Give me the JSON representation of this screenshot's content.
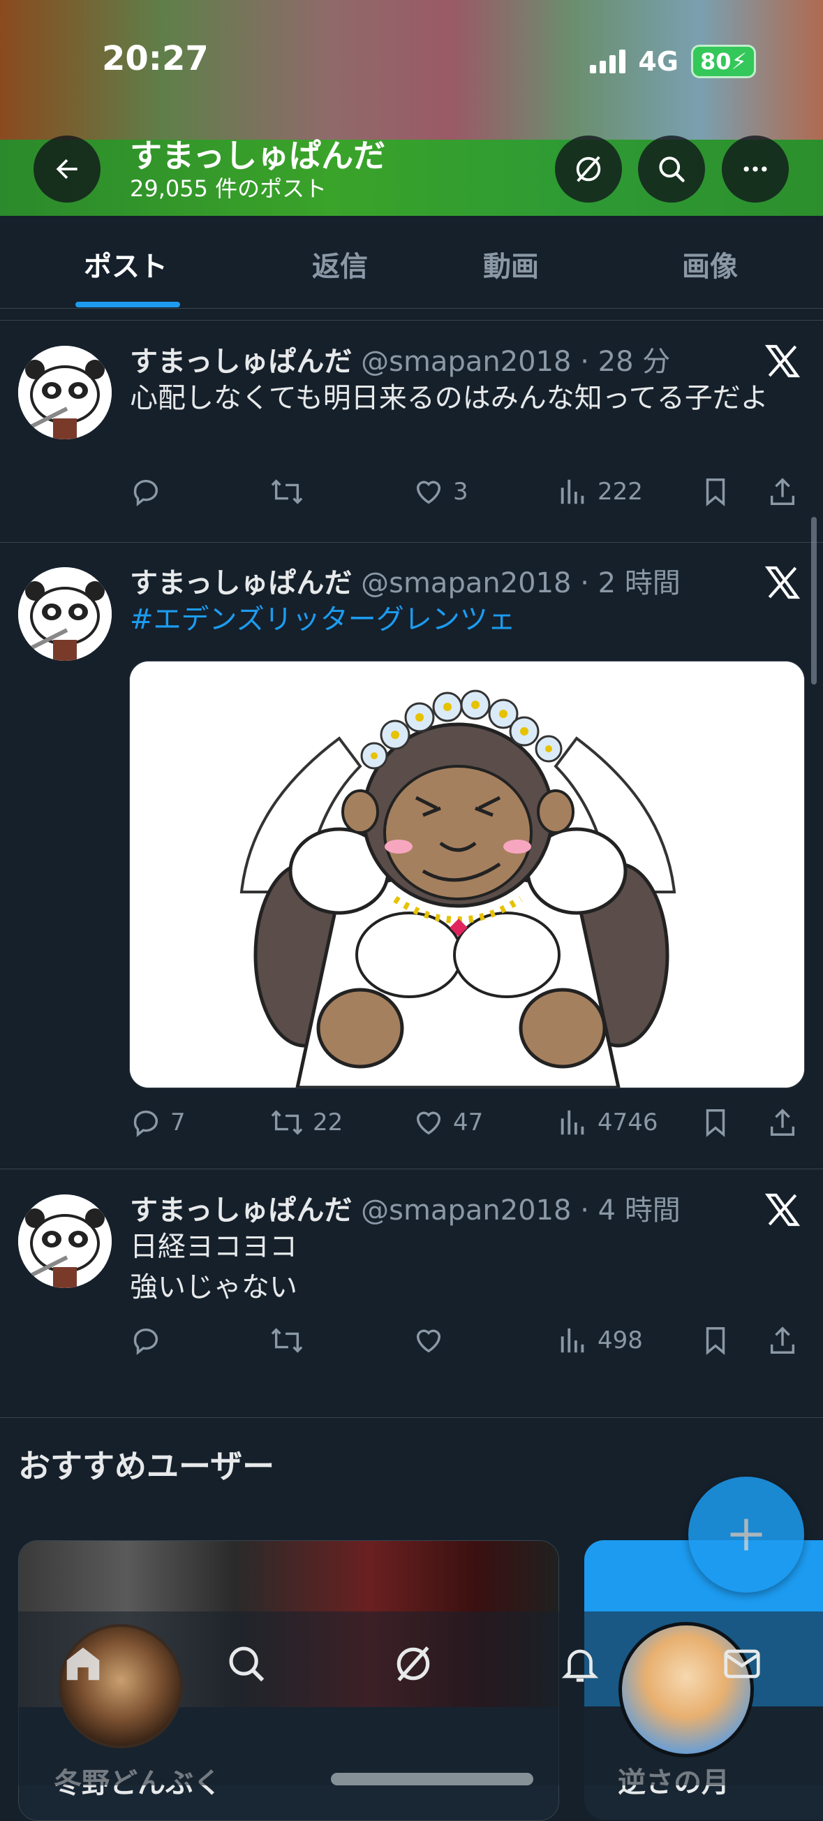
{
  "status_bar": {
    "time": "20:27",
    "network": "4G",
    "battery": "80"
  },
  "profile": {
    "name": "すまっしゅぱんだ",
    "post_count": "29,055 件のポスト"
  },
  "tabs": [
    {
      "label": "ポスト",
      "active": true
    },
    {
      "label": "返信",
      "active": false
    },
    {
      "label": "動画",
      "active": false
    },
    {
      "label": "画像",
      "active": false
    }
  ],
  "posts": [
    {
      "name": "すまっしゅぱんだ",
      "handle": "@smapan2018",
      "time": "· 28 分",
      "text": "心配しなくても明日来るのはみんな知ってる子だよ",
      "replies": "",
      "reposts": "",
      "likes": "3",
      "views": "222"
    },
    {
      "name": "すまっしゅぱんだ",
      "handle": "@smapan2018",
      "time": "· 2 時間",
      "hashtag": "#エデンズリッターグレンツェ",
      "image_alt": "gorilla in wedding dress illustration",
      "replies": "7",
      "reposts": "22",
      "likes": "47",
      "views": "4746"
    },
    {
      "name": "すまっしゅぱんだ",
      "handle": "@smapan2018",
      "time": "· 4 時間",
      "line1": "日経ヨコヨコ",
      "line2": "強いじゃない",
      "replies": "",
      "reposts": "",
      "likes": "",
      "views": "498"
    }
  ],
  "recommended": {
    "title": "おすすめユーザー",
    "cards": [
      {
        "name": "冬野どんぶく"
      },
      {
        "name": "逆さの月"
      }
    ]
  },
  "colors": {
    "background": "#15202b",
    "accent": "#1d9bf0",
    "muted": "#8b98a5",
    "text": "#e7e9ea"
  }
}
